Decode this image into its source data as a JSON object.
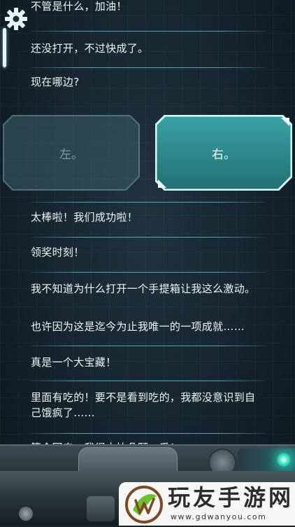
{
  "chat": {
    "messages": [
      {
        "text": "不管是什么，加油！"
      },
      {
        "text": "还没打开，不过快成了。"
      },
      {
        "text": "现在哪边?"
      },
      {
        "text": "太棒啦！我们成功啦！"
      },
      {
        "text": "领奖时刻！"
      },
      {
        "text": "我不知道为什么打开一个手提箱让我这么激动。"
      },
      {
        "text": "也许因为这是迄今为止我唯一的一项成就……"
      },
      {
        "text": "真是一个大宝藏！"
      },
      {
        "text": "里面有吃的！要不是看到吃的，我都没意识到自己饿疯了……"
      },
      {
        "text": "等会回来。我得太快朵颐一番！"
      }
    ]
  },
  "choices": [
    {
      "label": "左。",
      "state": "dim"
    },
    {
      "label": "右。",
      "state": "selected"
    }
  ],
  "icons": {
    "settings": "gear-icon",
    "watermark_logo": "leaf-w-logo"
  },
  "watermark": {
    "title": "玩友手游网",
    "url": "www.gdwanyou.com"
  },
  "colors": {
    "accent": "#41e3c4",
    "text": "#eef5f7",
    "choice_selected": "#2f8a8c"
  }
}
